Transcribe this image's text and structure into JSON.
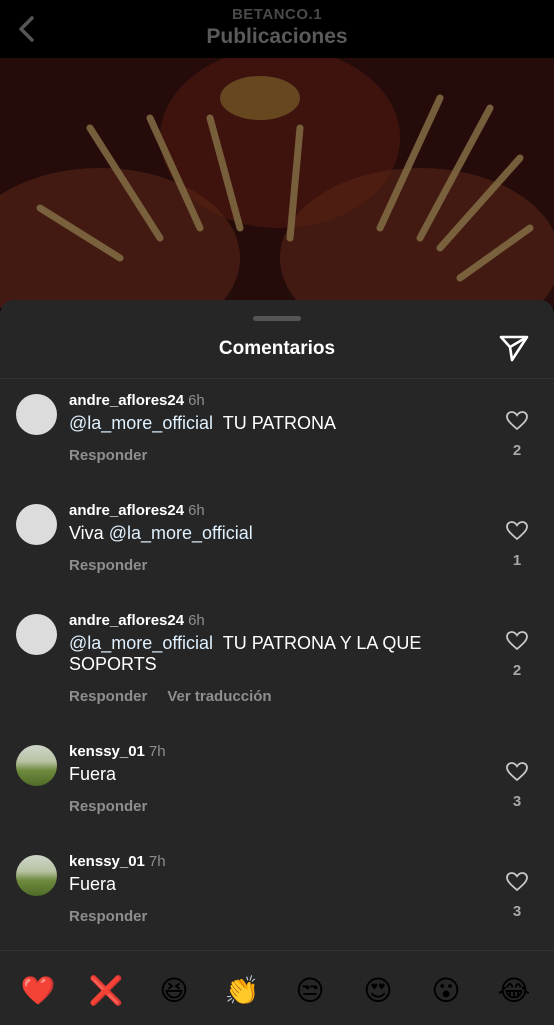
{
  "header": {
    "username": "BETANCO.1",
    "title": "Publicaciones"
  },
  "sheet": {
    "title": "Comentarios"
  },
  "comments": [
    {
      "user": "andre_aflores24",
      "time": "6h",
      "mention": "@la_more_official",
      "text": "  TU PATRONA",
      "prefix": "",
      "reply": "Responder",
      "translate": "",
      "likes": "2"
    },
    {
      "user": "andre_aflores24",
      "time": "6h",
      "mention": "@la_more_official",
      "text": "",
      "prefix": "Viva ",
      "reply": "Responder",
      "translate": "",
      "likes": "1"
    },
    {
      "user": "andre_aflores24",
      "time": "6h",
      "mention": "@la_more_official",
      "text": "  TU PATRONA Y LA QUE SOPORTS",
      "prefix": "",
      "reply": "Responder",
      "translate": "Ver traducción",
      "likes": "2"
    },
    {
      "user": "kenssy_01",
      "time": "7h",
      "mention": "",
      "text": "Fuera",
      "prefix": "",
      "reply": "Responder",
      "translate": "",
      "likes": "3"
    },
    {
      "user": "kenssy_01",
      "time": "7h",
      "mention": "",
      "text": "Fuera",
      "prefix": "",
      "reply": "Responder",
      "translate": "",
      "likes": "3"
    }
  ],
  "reactions": [
    "❤️",
    "❌",
    "😆",
    "👏",
    "😒",
    "😍",
    "😮",
    "😂"
  ],
  "colors": {
    "background": "#000000",
    "sheet": "#262626",
    "mention": "#e0f1ff",
    "muted": "#8e8e8e"
  }
}
